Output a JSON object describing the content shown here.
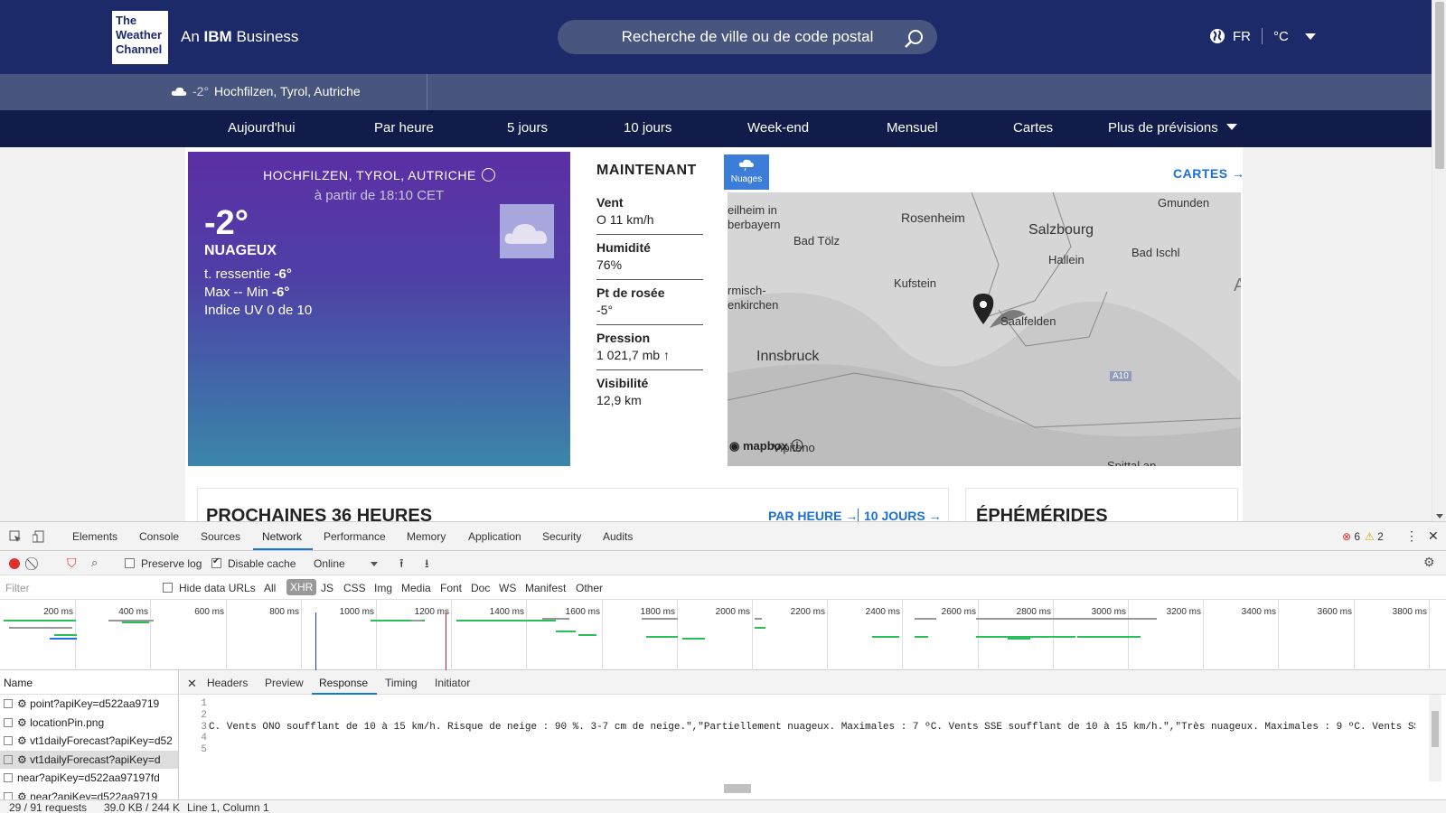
{
  "header": {
    "logo_lines": [
      "The",
      "Weather",
      "Channel"
    ],
    "business_prefix": "An",
    "business_brand": "IBM",
    "business_suffix": "Business",
    "search_placeholder": "Recherche de ville ou de code postal",
    "language": "FR",
    "unit": "°C"
  },
  "location_bar": {
    "temp": "-2°",
    "place": "Hochfilzen, Tyrol, Autriche"
  },
  "nav": {
    "items": [
      "Aujourd'hui",
      "Par heure",
      "5 jours",
      "10 jours",
      "Week-end",
      "Mensuel",
      "Cartes",
      "Plus de prévisions"
    ]
  },
  "hero": {
    "location": "HOCHFILZEN, TYROL, AUTRICHE",
    "as_of": "à partir de 18:10 CET",
    "temp": "-2°",
    "condition": "NUAGEUX",
    "feels_like_label": "t. ressentie",
    "feels_like": "-6°",
    "maxmin_label": "Max -- Min",
    "min": "-6°",
    "uv": "Indice UV 0 de 10"
  },
  "now": {
    "title": "MAINTENANT",
    "rows": [
      {
        "label": "Vent",
        "value": "O 11 km/h"
      },
      {
        "label": "Humidité",
        "value": "76%"
      },
      {
        "label": "Pt de rosée",
        "value": "-5°"
      },
      {
        "label": "Pression",
        "value": "1 021,7 mb"
      },
      {
        "label": "Visibilité",
        "value": "12,9 km"
      }
    ]
  },
  "map": {
    "badge": "Nuages",
    "link": "CARTES",
    "labels": [
      "eilheim in",
      "berbayern",
      "Bad Tölz",
      "Rosenheim",
      "Salzbourg",
      "Gmunden",
      "Bad Ischl",
      "Hallein",
      "Kufstein",
      "rmisch-",
      "enkirchen",
      "Saalfelden",
      "A",
      "Innsbruck",
      "A10",
      "Vipiteno",
      "Spittal an"
    ],
    "attribution": "mapbox"
  },
  "sections": {
    "next36": "PROCHAINES 36 HEURES",
    "link_hourly": "PAR HEURE",
    "link_10days": "10 JOURS",
    "ephemerides": "ÉPHÉMÉRIDES"
  },
  "devtools": {
    "tabs": [
      "Elements",
      "Console",
      "Sources",
      "Network",
      "Performance",
      "Memory",
      "Application",
      "Security",
      "Audits"
    ],
    "errors": "6",
    "warnings": "2",
    "preserve_log": "Preserve log",
    "disable_cache": "Disable cache",
    "throttle": "Online",
    "filter_placeholder": "Filter",
    "hide_data_urls": "Hide data URLs",
    "filter_types": [
      "All",
      "XHR",
      "JS",
      "CSS",
      "Img",
      "Media",
      "Font",
      "Doc",
      "WS",
      "Manifest",
      "Other"
    ],
    "timeline_ticks": [
      "200 ms",
      "400 ms",
      "600 ms",
      "800 ms",
      "1000 ms",
      "1200 ms",
      "1400 ms",
      "1600 ms",
      "1800 ms",
      "2000 ms",
      "2200 ms",
      "2400 ms",
      "2600 ms",
      "2800 ms",
      "3000 ms",
      "3200 ms",
      "3400 ms",
      "3600 ms",
      "3800 ms"
    ],
    "name_header": "Name",
    "requests": [
      "⚙ point?apiKey=d522aa9719",
      "⚙ locationPin.png",
      "⚙ vt1dailyForecast?apiKey=d52",
      "⚙ vt1dailyForecast?apiKey=d",
      "near?apiKey=d522aa97197fd",
      "⚙ near?apiKey=d522aa9719"
    ],
    "response_tabs": [
      "Headers",
      "Preview",
      "Response",
      "Timing",
      "Initiator"
    ],
    "line_numbers": [
      "1",
      "2",
      "3",
      "4",
      "5"
    ],
    "response_line": "C. Vents ONO soufflant de 10 à 15 km/h. Risque de neige : 90 %. 3-7 cm de neige.\",\"Partiellement nuageux. Maximales : 7 ºC. Vents SSE soufflant de 10 à 15 km/h.\",\"Très nuageux. Maximales : 9 ºC. Vents SSE",
    "status_requests": "29 / 91 requests",
    "status_size": "39.0 KB / 244 K",
    "status_cursor": "Line 1, Column 1"
  }
}
